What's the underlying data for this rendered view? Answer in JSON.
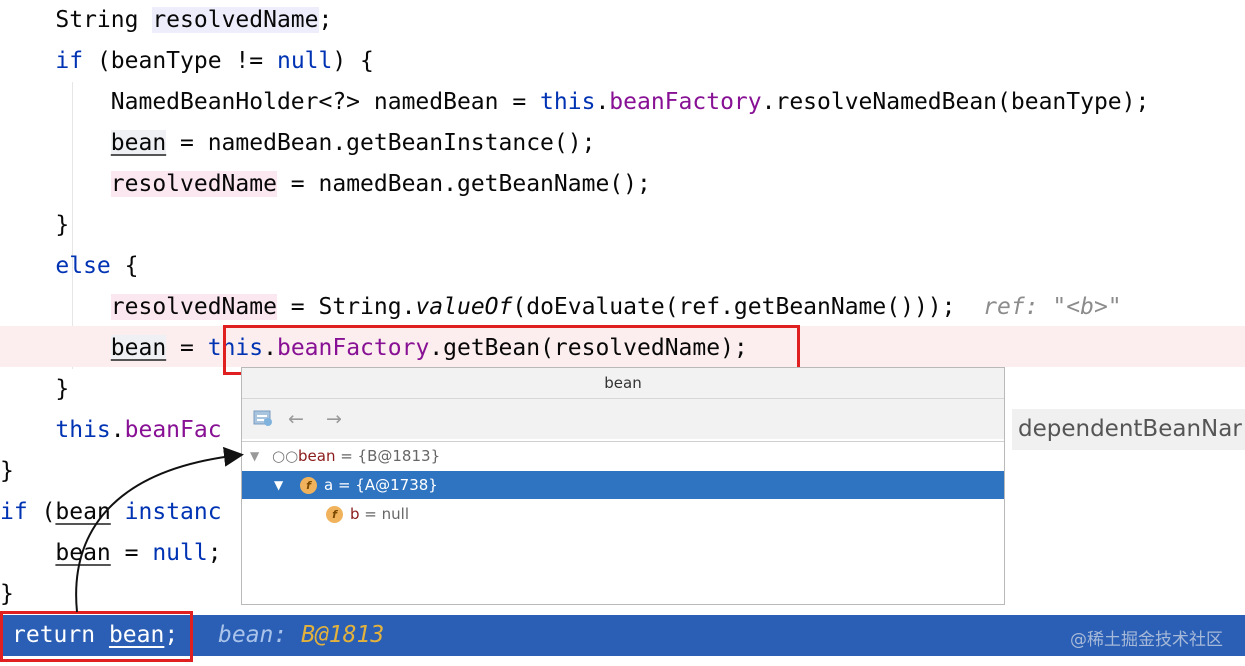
{
  "code": {
    "l1": {
      "a": "    String ",
      "b": "resolvedName",
      "c": ";"
    },
    "l2": {
      "a": "    ",
      "kw": "if",
      "b": " (beanType != ",
      "kw2": "null",
      "c": ") {"
    },
    "l3": {
      "a": "        NamedBeanHolder<?> namedBean = ",
      "kw": "this",
      "b": ".",
      "f": "beanFactory",
      "c": ".resolveNamedBean(beanType);"
    },
    "l4": {
      "a": "        ",
      "b": "bean",
      "c": " = namedBean.getBeanInstance();"
    },
    "l5": {
      "a": "        ",
      "b": "resolvedName",
      "c": " = namedBean.getBeanName();"
    },
    "l6": {
      "a": "    }"
    },
    "l7": {
      "a": "    ",
      "kw": "else",
      "b": " {"
    },
    "l8": {
      "a": "        ",
      "b": "resolvedName",
      "c": " = String.",
      "it": "valueOf",
      "d": "(doEvaluate(ref.getBeanName()));",
      "inlay": "  ref: \"<b>\""
    },
    "l9": {
      "a": "        ",
      "b": "bean",
      "c": " = ",
      "kw": "this",
      "d": ".",
      "f": "beanFactory",
      "e": ".getBean(resolvedName);"
    },
    "l10": {
      "a": "    }"
    },
    "l11": {
      "a": "    ",
      "kw": "this",
      "b": ".",
      "f": "beanFac"
    },
    "l12": {
      "a": "}"
    },
    "l13": {
      "kw": "if",
      "a": " (",
      "b": "bean",
      "c": " ",
      "kw2": "instanc"
    },
    "l14": {
      "a": "    ",
      "b": "bean",
      "c": " = ",
      "kw": "null",
      "d": ";"
    },
    "l15": {
      "a": "}"
    },
    "l16": {
      "kw": "return",
      "a": " ",
      "b": "bean",
      "c": ";"
    }
  },
  "exec_inlay": {
    "label": "bean: ",
    "value": "B@1813"
  },
  "side_text": "dependentBeanNar",
  "watermark": "@稀土掘金技术社区",
  "popup": {
    "title": "bean",
    "toolbar": {
      "back": "←",
      "forward": "→"
    },
    "tree": [
      {
        "name": "bean",
        "rest": " = {B@1813}",
        "expanded": true
      },
      {
        "name": "a",
        "rest": " = {A@1738}",
        "expanded": true,
        "selected": true
      },
      {
        "name": "b",
        "rest": " = null"
      }
    ]
  },
  "colors": {
    "keyword": "#0033b3",
    "field": "#871094",
    "exec_line": "#2a5fb5",
    "red_box": "#e02020",
    "selection": "#2f74c0"
  }
}
